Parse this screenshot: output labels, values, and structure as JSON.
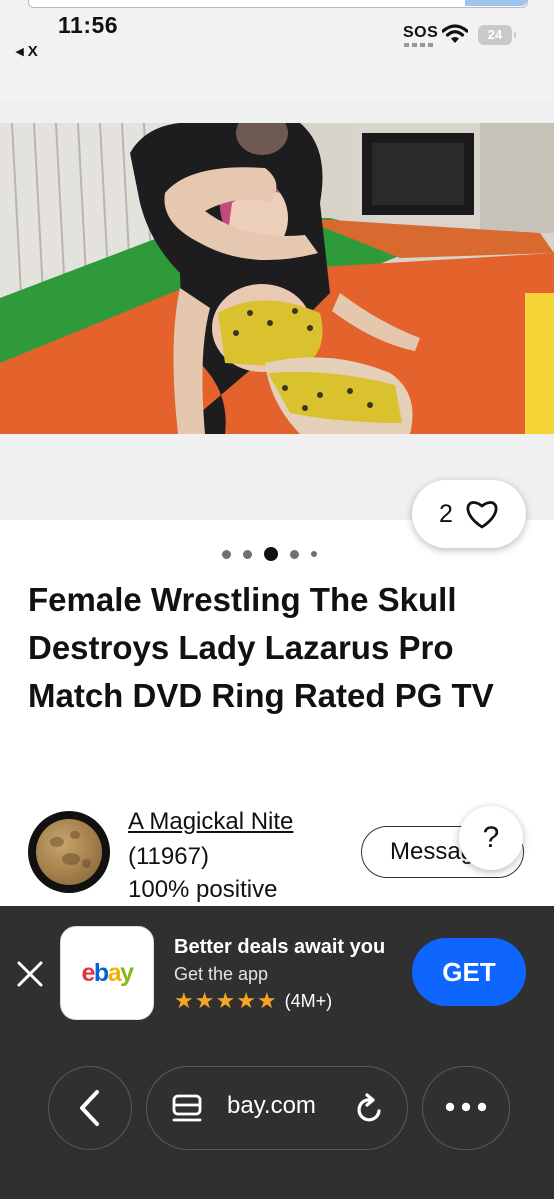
{
  "status_bar": {
    "time": "11:56",
    "back_app": "◂ X",
    "sos": "SOS",
    "battery": "24"
  },
  "listing": {
    "like_count": "2",
    "carousel": {
      "count": 5,
      "active_index": 2
    },
    "title": "Female Wrestling The Skull Destroys Lady Lazarus Pro Match DVD Ring Rated PG TV"
  },
  "seller": {
    "name": "A Magickal Nite",
    "score": "(11967)",
    "positive": "100% positive",
    "message_label": "Message",
    "help_label": "?"
  },
  "app_banner": {
    "logo_letters": [
      "e",
      "b",
      "a",
      "y"
    ],
    "logo_colors": [
      "#e53238",
      "#0064d2",
      "#f5af02",
      "#86b817"
    ],
    "headline": "Better deals await you",
    "subtitle": "Get the app",
    "rating_stars": 5,
    "rating_count": "(4M+)",
    "get_label": "GET"
  },
  "browser": {
    "url": "bay.com",
    "icons": [
      "chevron-left-icon",
      "page-icon",
      "reload-icon",
      "more-icon"
    ]
  }
}
